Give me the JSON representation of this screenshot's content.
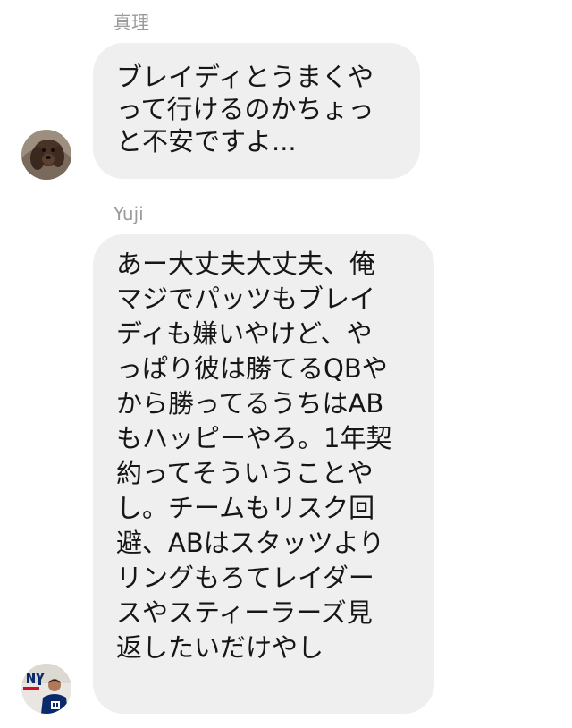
{
  "messages": [
    {
      "sender": "真理",
      "lines": [
        "ブレイディとうまくや",
        "って行けるのかちょっ",
        "と不安ですよ..."
      ],
      "avatar_icon": "dog-avatar-icon"
    },
    {
      "sender": "Yuji",
      "lines": [
        "あー大丈夫大丈夫、俺",
        "マジでパッツもブレイ",
        "ディも嫌いやけど、や",
        "っぱり彼は勝てるQBや",
        "から勝ってるうちはAB",
        "もハッピーやろ。1年契",
        "約ってそういうことや",
        "し。チームもリスク回",
        "避、ABはスタッツより",
        "リングもろてレイダー",
        "スやスティーラーズ見",
        "返したいだけやし"
      ],
      "avatar_icon": "giants-fan-avatar-icon"
    }
  ],
  "colors": {
    "bubble": "#efefef",
    "sender_label": "#9b9b9b",
    "text": "#161616"
  }
}
